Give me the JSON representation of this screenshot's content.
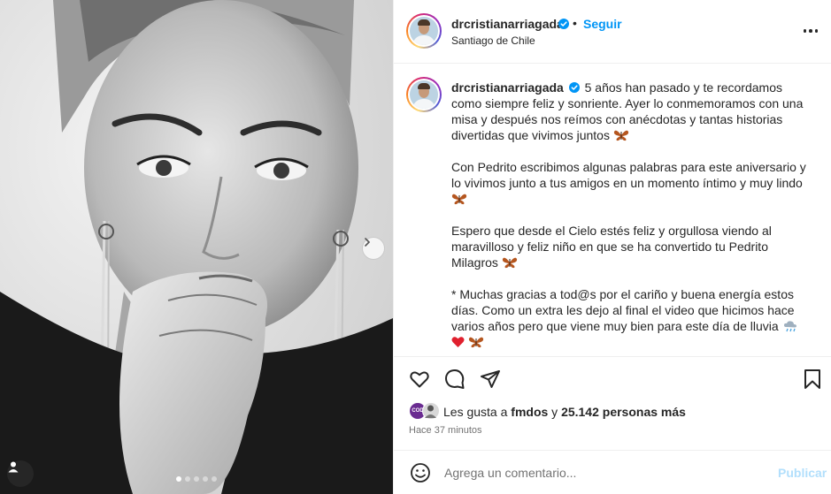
{
  "post": {
    "username": "drcristianarriagada",
    "follow_label": "Seguir",
    "separator": "•",
    "location": "Santiago de Chile",
    "image_count": 5,
    "active_image": 1
  },
  "caption": {
    "username": "drcristianarriagada",
    "paragraphs": [
      "5 años han pasado y te recordamos como siempre feliz y sonriente. Ayer lo conmemoramos con una misa y después nos reímos con anécdotas y tantas historias divertidas que vivimos juntos",
      "Con Pedrito escribimos algunas palabras para este aniversario y lo vivimos junto a tus amigos en un momento íntimo y muy lindo",
      "Espero que desde el Cielo estés feliz y orgullosa viendo al maravilloso y feliz niño en que se ha convertido tu Pedrito Milagros",
      "* Muchas gracias a tod@s por el cariño y buena energía estos días. Como un extra les dejo al final el video que hicimos hace varios años pero que viene muy bien para este día de lluvia"
    ]
  },
  "likes": {
    "prefix": "Les gusta a",
    "first_user": "fmdos",
    "connector": "y",
    "count_text": "25.142 personas más",
    "avatar_label": "COD"
  },
  "timestamp": "Hace 37 minutos",
  "comment": {
    "placeholder": "Agrega un comentario...",
    "publish_label": "Publicar"
  },
  "icons": {
    "verified": "verified-badge-icon",
    "more": "more-options-icon",
    "next": "chevron-right-icon",
    "tag": "user-tag-icon",
    "like": "heart-outline-icon",
    "comment": "comment-icon",
    "share": "paper-plane-icon",
    "save": "bookmark-icon",
    "emoji": "emoji-smile-icon",
    "butterfly": "butterfly-emoji",
    "rain": "rain-cloud-emoji",
    "red_heart": "red-heart-emoji"
  },
  "colors": {
    "accent_blue": "#0095f6",
    "publish_disabled": "#b2dffc",
    "muted_text": "#737373",
    "verified_blue": "#0095f6"
  }
}
